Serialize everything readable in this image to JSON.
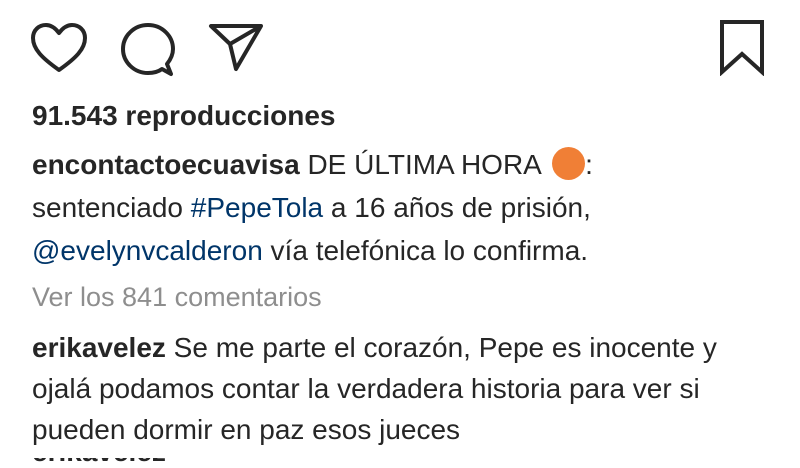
{
  "actions": {
    "like_icon": "heart-outline-icon",
    "comment_icon": "speech-bubble-icon",
    "share_icon": "paper-plane-icon",
    "save_icon": "bookmark-icon"
  },
  "views": {
    "text": "91.543 reproducciones"
  },
  "caption": {
    "username": "encontactoecuavisa",
    "text_before_dot": " DE ÚLTIMA HORA",
    "dot_color": "#f07f36",
    "text_after_dot": ":",
    "line2_prefix": "sentenciado ",
    "hashtag": "#PepeTola",
    "line2_suffix": " a 16 años de prisión,",
    "mention": "@evelynvcalderon",
    "line3_suffix": " vía telefónica lo confirma."
  },
  "view_comments": {
    "label": "Ver los 841 comentarios"
  },
  "comment": {
    "username": "erikavelez",
    "text": " Se me parte el corazón, Pepe es inocente y ojalá podamos contar la verdadera historia para ver si pueden dormir en paz esos jueces"
  },
  "next_comment_partial": {
    "username": "erikavelez"
  },
  "colors": {
    "text": "#262626",
    "link": "#003569",
    "muted": "#8e8e8e"
  }
}
